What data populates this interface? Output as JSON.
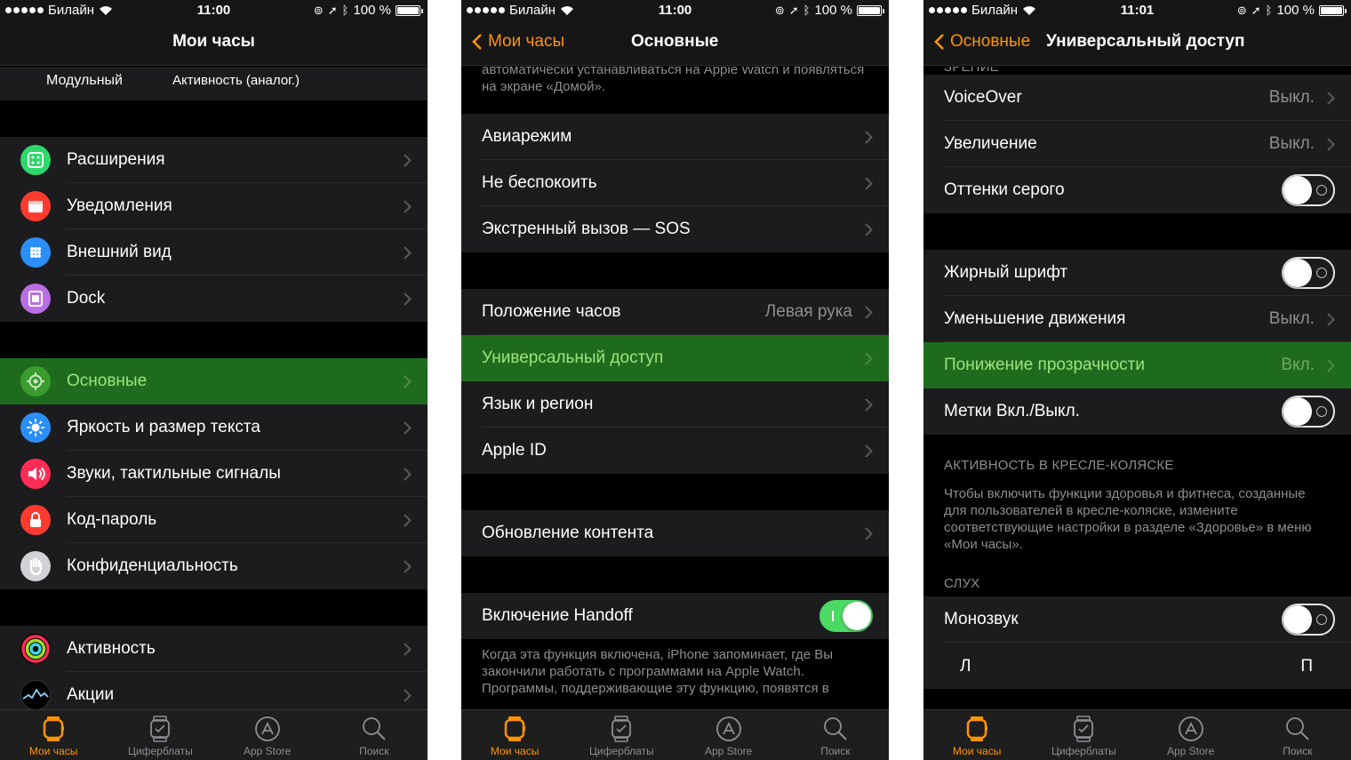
{
  "status": {
    "carrier": "Билайн",
    "battery": "100 %",
    "times": [
      "11:00",
      "11:00",
      "11:01"
    ]
  },
  "tabs": {
    "my_watch": "Мои часы",
    "faces": "Циферблаты",
    "app_store": "App Store",
    "search": "Поиск"
  },
  "colors": {
    "accent": "#ff9500",
    "selected_row": "#1f6b1e",
    "selected_text": "#9fe37c",
    "switch_on": "#4cd964",
    "secondary_text": "#8e8e93"
  },
  "screen1": {
    "title": "Мои часы",
    "faces": [
      "Модульный",
      "Активность (аналог.)"
    ],
    "group1": [
      {
        "label": "Расширения",
        "icon": "complications-icon",
        "color": "#2fd86a"
      },
      {
        "label": "Уведомления",
        "icon": "notifications-icon",
        "color": "#ff3b30"
      },
      {
        "label": "Внешний вид",
        "icon": "app-layout-icon",
        "color": "#2c8ef8"
      },
      {
        "label": "Dock",
        "icon": "dock-icon",
        "color": "#b96ee6"
      }
    ],
    "group2": [
      {
        "label": "Основные",
        "icon": "gear-icon",
        "color": "#3a9b2f",
        "selected": true
      },
      {
        "label": "Яркость и размер текста",
        "icon": "brightness-icon",
        "color": "#2c8ef8"
      },
      {
        "label": "Звуки, тактильные сигналы",
        "icon": "speaker-icon",
        "color": "#ff2d55"
      },
      {
        "label": "Код-пароль",
        "icon": "lock-icon",
        "color": "#ff3b30"
      },
      {
        "label": "Конфиденциальность",
        "icon": "hand-icon",
        "color": "#d1d1d6"
      }
    ],
    "group3": [
      {
        "label": "Активность",
        "icon": "activity-rings-icon",
        "color": "#000000"
      },
      {
        "label": "Акции",
        "icon": "stocks-icon",
        "color": "#000000"
      }
    ]
  },
  "screen2": {
    "back": "Мои часы",
    "title": "Основные",
    "top_footer": "автоматически устанавливаться на Apple Watch и появляться на экране «Домой».",
    "group1": [
      "Авиарежим",
      "Не беспокоить",
      "Экстренный вызов — SOS"
    ],
    "group2": [
      {
        "label": "Положение часов",
        "value": "Левая рука"
      },
      {
        "label": "Универсальный доступ",
        "value": "",
        "selected": true
      },
      {
        "label": "Язык и регион",
        "value": ""
      },
      {
        "label": "Apple ID",
        "value": ""
      }
    ],
    "group3": [
      "Обновление контента"
    ],
    "handoff_label": "Включение Handoff",
    "handoff_on": true,
    "handoff_footer": "Когда эта функция включена, iPhone запоминает, где Вы закончили работать с программами на Apple Watch. Программы, поддерживающие эту функцию, появятся в"
  },
  "screen3": {
    "back": "Основные",
    "title": "Универсальный доступ",
    "clipped_header": "ЗРЕНИЕ",
    "group1": [
      {
        "label": "VoiceOver",
        "value": "Выкл.",
        "type": "chevron"
      },
      {
        "label": "Увеличение",
        "value": "Выкл.",
        "type": "chevron"
      },
      {
        "label": "Оттенки серого",
        "value": "",
        "type": "switch"
      }
    ],
    "group2": [
      {
        "label": "Жирный шрифт",
        "value": "",
        "type": "switch"
      },
      {
        "label": "Уменьшение движения",
        "value": "Выкл.",
        "type": "chevron"
      },
      {
        "label": "Понижение прозрачности",
        "value": "Вкл.",
        "type": "chevron",
        "selected": true
      },
      {
        "label": "Метки Вкл./Выкл.",
        "value": "",
        "type": "switch"
      }
    ],
    "wheelchair_header": "АКТИВНОСТЬ В КРЕСЛЕ-КОЛЯСКЕ",
    "wheelchair_footer": "Чтобы включить функции здоровья и фитнеса, созданные для пользователей в кресле-коляске, измените соответствующие настройки в разделе «Здоровье» в меню «Мои часы».",
    "hearing_header": "СЛУХ",
    "mono_label": "Монозвук",
    "balance_left": "Л",
    "balance_right": "П"
  }
}
